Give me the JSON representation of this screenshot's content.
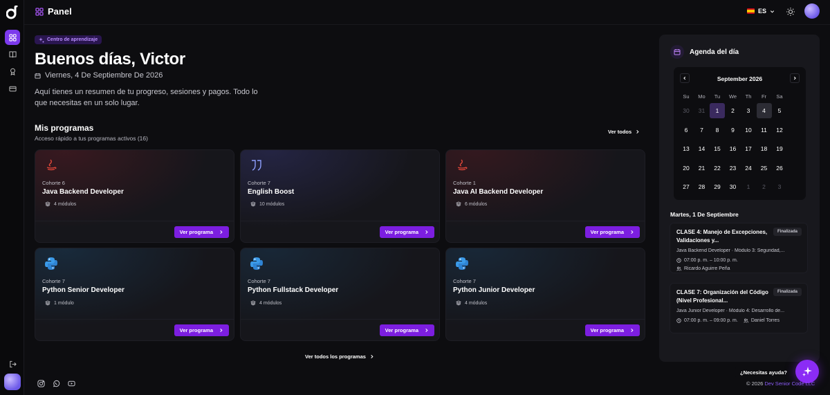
{
  "topbar": {
    "title": "Panel",
    "language": "ES"
  },
  "sidebar": {
    "items": [
      {
        "icon": "dashboard-icon",
        "active": true
      },
      {
        "icon": "book-icon",
        "active": false
      },
      {
        "icon": "award-icon",
        "active": false
      },
      {
        "icon": "credit-card-icon",
        "active": false
      }
    ],
    "logout_icon": "logout-icon"
  },
  "main": {
    "badge": "Centro de aprendizaje",
    "greeting": "Buenos días, Victor",
    "date": "Viernes, 4 De Septiembre De 2026",
    "summary": "Aquí tienes un resumen de tu progreso, sesiones y pagos. Todo lo que necesitas en un solo lugar.",
    "programs_title": "Mis programas",
    "programs_subtitle": "Acceso rápido a tus programas activos (16)",
    "see_all": "Ver todos",
    "see_all_programs": "Ver todos los programas",
    "button_label": "Ver programa",
    "programs": [
      {
        "cohort": "Cohorte 6",
        "title": "Java Backend Developer",
        "modules": "4 módulos",
        "icon": "java-icon"
      },
      {
        "cohort": "Cohorte 7",
        "title": "English Boost",
        "modules": "10 módulos",
        "icon": "quote-icon"
      },
      {
        "cohort": "Cohorte 1",
        "title": "Java AI Backend Developer",
        "modules": "6 módulos",
        "icon": "java-icon"
      },
      {
        "cohort": "Cohorte 7",
        "title": "Python Senior Developer",
        "modules": "1 módulo",
        "icon": "python-icon"
      },
      {
        "cohort": "Cohorte 7",
        "title": "Python Fullstack Developer",
        "modules": "4 módulos",
        "icon": "python-icon"
      },
      {
        "cohort": "Cohorte 7",
        "title": "Python Junior Developer",
        "modules": "4 módulos",
        "icon": "python-icon"
      }
    ]
  },
  "agenda": {
    "title": "Agenda del día",
    "month": "September 2026",
    "weekdays": [
      "Su",
      "Mo",
      "Tu",
      "We",
      "Th",
      "Fr",
      "Sa"
    ],
    "days": [
      [
        "30",
        "31",
        "1",
        "2",
        "3",
        "4",
        "5"
      ],
      [
        "6",
        "7",
        "8",
        "9",
        "10",
        "11",
        "12"
      ],
      [
        "13",
        "14",
        "15",
        "16",
        "17",
        "18",
        "19"
      ],
      [
        "20",
        "21",
        "22",
        "23",
        "24",
        "25",
        "26"
      ],
      [
        "27",
        "28",
        "29",
        "30",
        "1",
        "2",
        "3"
      ]
    ],
    "selected_day": "1",
    "today": "4",
    "selected_date": "Martes, 1 De Septiembre",
    "sessions": [
      {
        "title": "CLASE 4: Manejo de Excepciones, Validaciones y...",
        "status": "Finalizada",
        "program": "Java Backend Developer · Módulo 3: Seguridad,...",
        "time": "07:00 p. m. – 10:00 p. m.",
        "instructor": "Ricardo Aguirre Peña"
      },
      {
        "title": "CLASE 7: Organización del Código (Nivel Profesional...",
        "status": "Finalizada",
        "program": "Java Junior Developer · Módulo 4: Desarrollo de...",
        "time": "07:00 p. m. – 09:00 p. m.",
        "instructor": "Daniel Torres"
      }
    ]
  },
  "footer": {
    "help": "¿Necesitas ayuda?",
    "copyright_prefix": "© 2026 ",
    "copyright_brand": "Dev Senior Code LLC",
    "socials": [
      "instagram-icon",
      "whatsapp-icon",
      "youtube-icon"
    ]
  }
}
